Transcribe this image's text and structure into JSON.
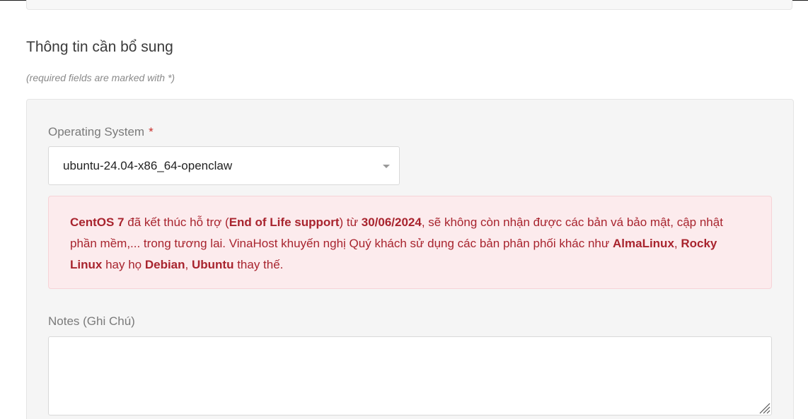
{
  "section": {
    "title": "Thông tin cần bổ sung",
    "required_note": "(required fields are marked with *)"
  },
  "os_field": {
    "label": "Operating System",
    "required_marker": "*",
    "selected_value": "ubuntu-24.04-x86_64-openclaw"
  },
  "notice": {
    "segments": [
      {
        "text": "CentOS 7",
        "bold": true
      },
      {
        "text": " đã kết thúc hỗ trợ (",
        "bold": false
      },
      {
        "text": "End of Life support",
        "bold": true
      },
      {
        "text": ") từ ",
        "bold": false
      },
      {
        "text": "30/06/2024",
        "bold": true
      },
      {
        "text": ", sẽ không còn nhận được các bản vá bảo mật, cập nhật phần mềm,... trong tương lai. VinaHost khuyến nghị Quý khách sử dụng các bản phân phối khác như ",
        "bold": false
      },
      {
        "text": "AlmaLinux",
        "bold": true
      },
      {
        "text": ", ",
        "bold": false
      },
      {
        "text": "Rocky Linux",
        "bold": true
      },
      {
        "text": " hay họ ",
        "bold": false
      },
      {
        "text": "Debian",
        "bold": true
      },
      {
        "text": ", ",
        "bold": false
      },
      {
        "text": "Ubuntu",
        "bold": true
      },
      {
        "text": " thay thế.",
        "bold": false
      }
    ]
  },
  "notes_field": {
    "label": "Notes (Ghi Chú)",
    "value": ""
  },
  "colors": {
    "alert_text": "#a8242e",
    "alert_background": "#fcebed",
    "required_star": "#c9302c",
    "panel_background": "#f5f5f5"
  },
  "icons": {
    "select_caret": "caret-down-icon",
    "textarea_grip": "resize-grip-icon"
  }
}
